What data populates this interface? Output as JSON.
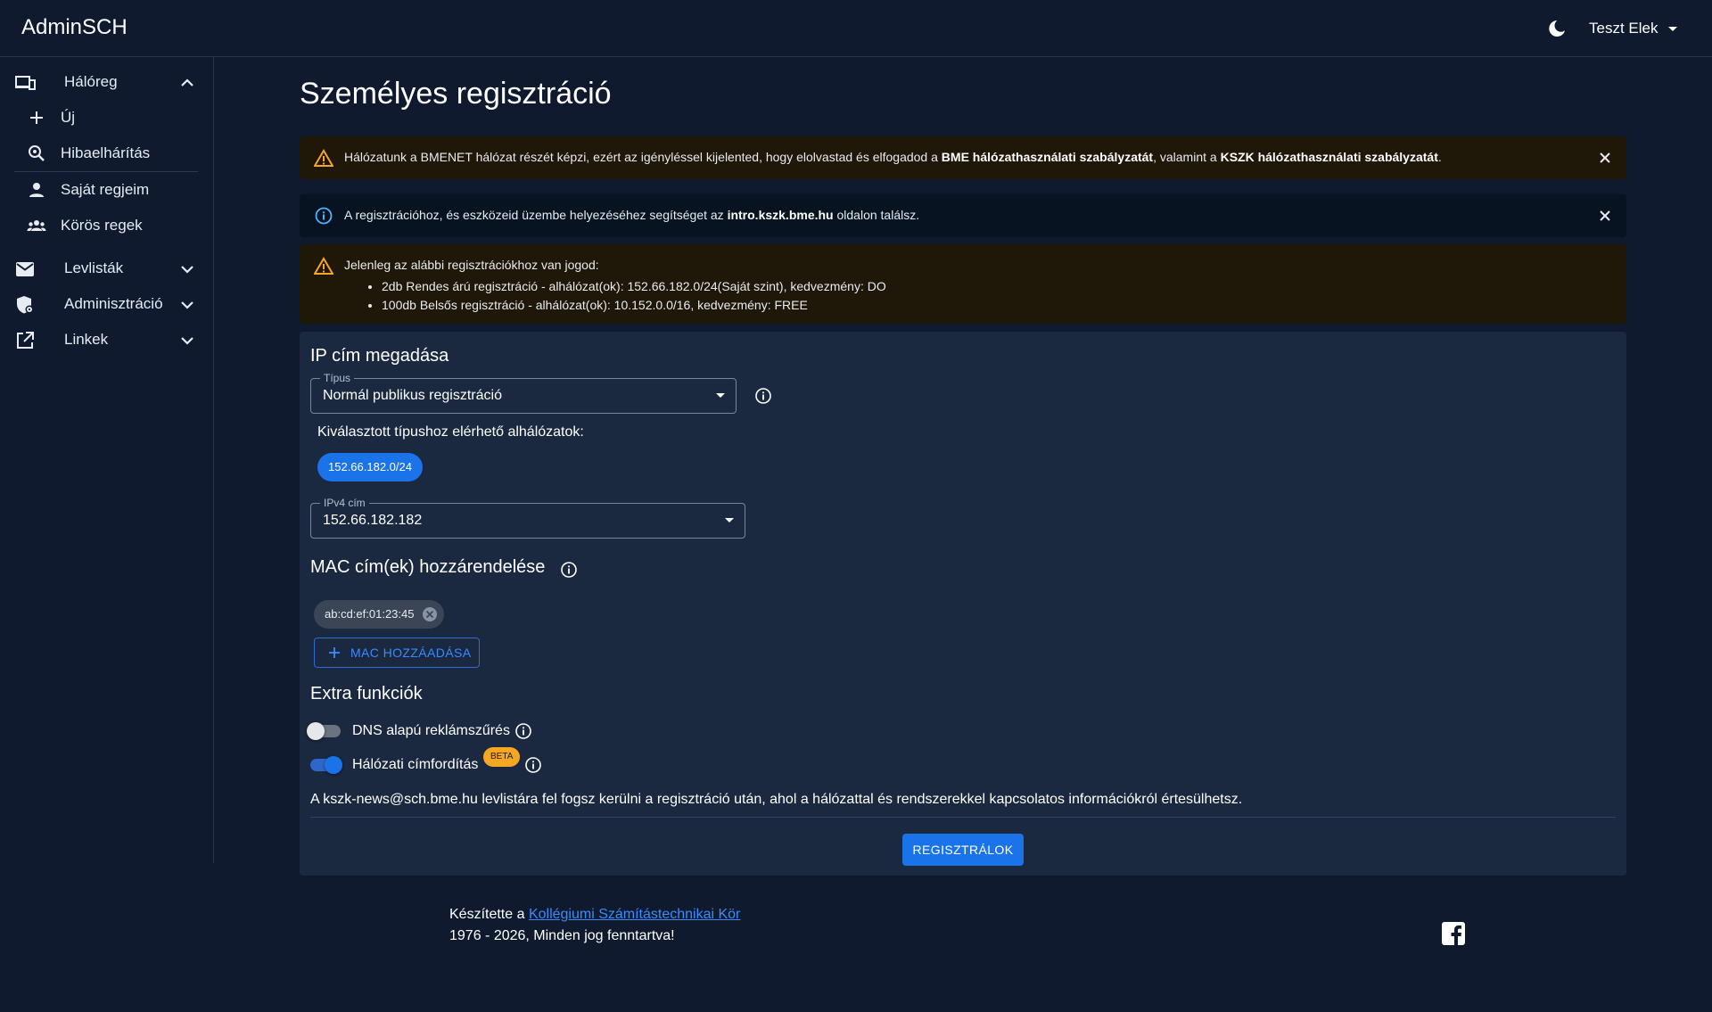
{
  "app": {
    "title": "AdminSCH"
  },
  "header": {
    "user_name": "Teszt Elek"
  },
  "sidebar": {
    "items": [
      {
        "label": "Hálóreg",
        "icon": "devices-icon"
      },
      {
        "label": "Levlisták",
        "icon": "mail-icon"
      },
      {
        "label": "Adminisztráció",
        "icon": "admin-shield-icon"
      },
      {
        "label": "Linkek",
        "icon": "external-link-icon"
      }
    ],
    "subitems": [
      {
        "label": "Új",
        "icon": "plus-icon"
      },
      {
        "label": "Hibaelhárítás",
        "icon": "search-icon"
      },
      {
        "label": "Saját regjeim",
        "icon": "person-icon"
      },
      {
        "label": "Körös regek",
        "icon": "group-icon"
      }
    ]
  },
  "main": {
    "title": "Személyes regisztráció",
    "alert_terms": {
      "text1": "Hálózatunk a BMENET hálózat részét képzi, ezért az igényléssel kijelented, hogy elolvastad és elfogadod a ",
      "link1": "BME hálózathasználati szabályzatát",
      "text2": ", valamint a ",
      "link2": "KSZK hálózathasználati szabályzatát",
      "text3": "."
    },
    "alert_help": {
      "text1": "A regisztrációhoz, és eszközeid üzembe helyezéséhez segítséget az ",
      "link": "intro.kszk.bme.hu",
      "text2": " oldalon találsz."
    },
    "alert_rights": {
      "intro": "Jelenleg az alábbi regisztrációkhoz van jogod:",
      "items": [
        "2db Rendes árú regisztráció - alhálózat(ok): 152.66.182.0/24(Saját szint), kedvezmény: DO",
        "100db Belsős regisztráció - alhálózat(ok): 10.152.0.0/16, kedvezmény: FREE"
      ]
    },
    "ip_section": {
      "title": "IP cím megadása",
      "type_label": "Típus",
      "type_value": "Normál publikus regisztráció",
      "subnets_label": "Kiválasztott típushoz elérhető alhálózatok:",
      "subnet_chip": "152.66.182.0/24",
      "ipv4_label": "IPv4 cím",
      "ipv4_value": "152.66.182.182"
    },
    "mac_section": {
      "title": "MAC cím(ek) hozzárendelése",
      "chip": "ab:cd:ef:01:23:45",
      "add_button": "MAC HOZZÁADÁSA"
    },
    "extra_section": {
      "title": "Extra funkciók",
      "dns_label": "DNS alapú reklámszűrés",
      "dns_enabled": false,
      "nat_label": "Hálózati címfordítás",
      "nat_enabled": true,
      "beta": "BETA"
    },
    "newsletter_text": "A kszk-news@sch.bme.hu levlistára fel fogsz kerülni a regisztráció után, ahol a hálózattal és rendszerekkel kapcsolatos információkról értesülhetsz.",
    "submit_button": "REGISZTRÁLOK"
  },
  "footer": {
    "made_by": "Készítette a ",
    "org_link": "Kollégiumi Számítástechnikai Kör",
    "copyright": "1976 - 2026, Minden jog fenntartva!"
  },
  "colors": {
    "background": "#0f1a2e",
    "card": "#1a2840",
    "primary": "#1a73e8",
    "warning": "#f5a623",
    "info": "#4fb3ff"
  }
}
